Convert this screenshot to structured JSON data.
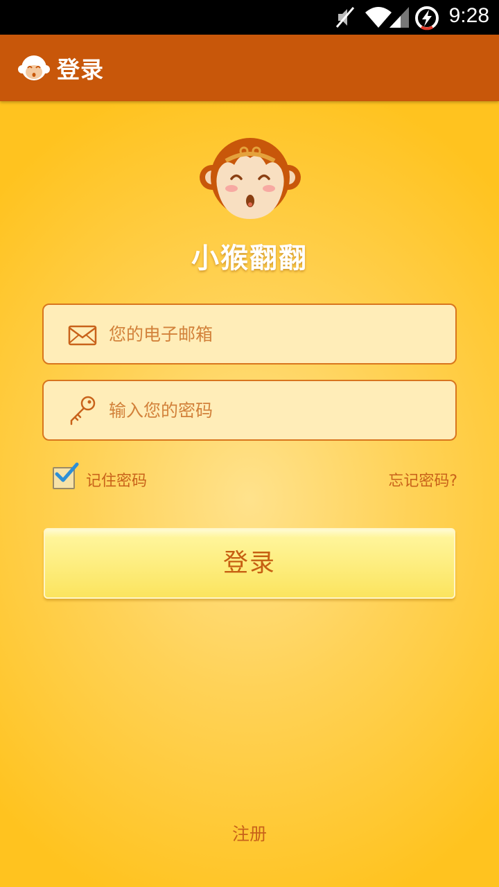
{
  "status_bar": {
    "time": "9:28",
    "icons": [
      "mute-icon",
      "wifi-icon",
      "signal-icon",
      "battery-charging-icon"
    ]
  },
  "action_bar": {
    "logo_icon": "monkey-logo-icon",
    "title": "登录"
  },
  "app": {
    "avatar_icon": "monkey-face-icon",
    "name": "小猴翻翻"
  },
  "form": {
    "email": {
      "icon": "envelope-icon",
      "placeholder": "您的电子邮箱",
      "value": ""
    },
    "password": {
      "icon": "key-icon",
      "placeholder": "输入您的密码",
      "value": ""
    },
    "remember": {
      "label": "记住密码",
      "checked": true
    },
    "forgot_label": "忘记密码?",
    "login_label": "登录"
  },
  "register_label": "注册",
  "colors": {
    "action_bar": "#c8570a",
    "background": "#ffc31f",
    "field_fill": "#ffedb8",
    "field_border": "#d8751d",
    "accent_text": "#c8621a",
    "button": "#fbe45e"
  }
}
